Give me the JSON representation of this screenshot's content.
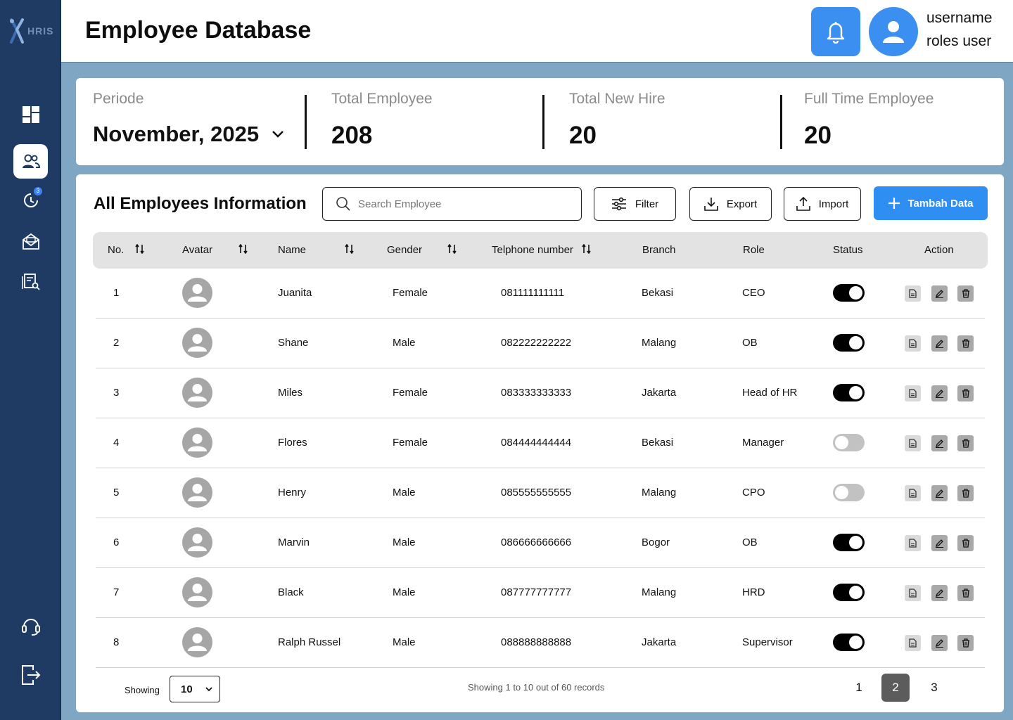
{
  "app": {
    "logo_text": "HRIS",
    "page_title": "Employee Database"
  },
  "sidebar": {
    "items": [
      {
        "name": "dashboard",
        "icon": "grid-icon"
      },
      {
        "name": "employees",
        "icon": "users-icon",
        "active": true
      },
      {
        "name": "attendance",
        "icon": "clock-icon",
        "badge": "3"
      },
      {
        "name": "mail",
        "icon": "mail-icon"
      },
      {
        "name": "reports",
        "icon": "report-search-icon"
      },
      {
        "name": "support",
        "icon": "headset-icon"
      },
      {
        "name": "logout",
        "icon": "logout-icon"
      }
    ]
  },
  "header": {
    "username": "username",
    "role": "roles user"
  },
  "stats": {
    "periode_label": "Periode",
    "periode_value": "November, 2025",
    "total_employee_label": "Total Employee",
    "total_employee_value": "208",
    "total_new_hire_label": "Total New Hire",
    "total_new_hire_value": "20",
    "full_time_label": "Full Time Employee",
    "full_time_value": "20"
  },
  "table_section": {
    "title": "All Employees Information",
    "search_placeholder": "Search Employee",
    "filter_label": "Filter",
    "export_label": "Export",
    "import_label": "Import",
    "add_label": "Tambah Data"
  },
  "table": {
    "columns": {
      "no": "No.",
      "avatar": "Avatar",
      "name": "Name",
      "gender": "Gender",
      "phone": "Telphone number",
      "branch": "Branch",
      "role": "Role",
      "status": "Status",
      "action": "Action"
    },
    "rows": [
      {
        "no": "1",
        "name": "Juanita",
        "gender": "Female",
        "phone": "081111111111",
        "branch": "Bekasi",
        "role": "CEO",
        "status": "on"
      },
      {
        "no": "2",
        "name": "Shane",
        "gender": "Male",
        "phone": "082222222222",
        "branch": "Malang",
        "role": "OB",
        "status": "on"
      },
      {
        "no": "3",
        "name": "Miles",
        "gender": "Female",
        "phone": "083333333333",
        "branch": "Jakarta",
        "role": "Head of HR",
        "status": "on"
      },
      {
        "no": "4",
        "name": "Flores",
        "gender": "Female",
        "phone": "084444444444",
        "branch": "Bekasi",
        "role": "Manager",
        "status": "off"
      },
      {
        "no": "5",
        "name": "Henry",
        "gender": "Male",
        "phone": "085555555555",
        "branch": "Malang",
        "role": "CPO",
        "status": "off"
      },
      {
        "no": "6",
        "name": "Marvin",
        "gender": "Male",
        "phone": "086666666666",
        "branch": "Bogor",
        "role": "OB",
        "status": "on"
      },
      {
        "no": "7",
        "name": "Black",
        "gender": "Male",
        "phone": "087777777777",
        "branch": "Malang",
        "role": "HRD",
        "status": "on"
      },
      {
        "no": "8",
        "name": "Ralph Russel",
        "gender": "Male",
        "phone": "088888888888",
        "branch": "Jakarta",
        "role": "Supervisor",
        "status": "on"
      }
    ]
  },
  "pagination": {
    "showing_label": "Showing",
    "page_size": "10",
    "records_info": "Showing 1 to 10 out of 60 records",
    "pages": [
      "1",
      "2",
      "3"
    ],
    "current_page": "2"
  },
  "colors": {
    "sidebar_bg": "#1f3b64",
    "page_bg": "#7fa7c4",
    "accent": "#2f8ef2",
    "toggle_on": "#000000",
    "toggle_off": "#c2c2c2"
  }
}
